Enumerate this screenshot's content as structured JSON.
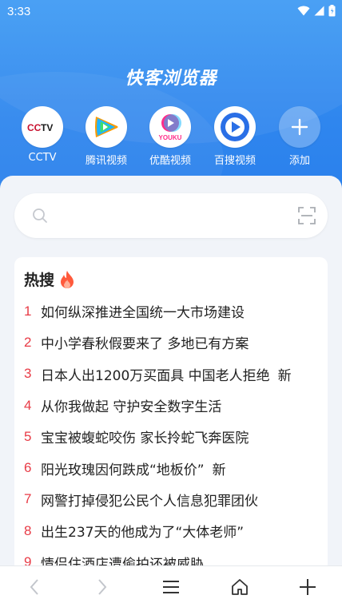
{
  "status": {
    "time": "3:33"
  },
  "app": {
    "title": "快客浏览器"
  },
  "shortcuts": [
    {
      "label": "CCTV",
      "icon": "cctv-logo-icon"
    },
    {
      "label": "腾讯视频",
      "icon": "tencent-video-icon"
    },
    {
      "label": "优酷视频",
      "icon": "youku-icon",
      "logo_text": "YOUKU"
    },
    {
      "label": "百搜视频",
      "icon": "baisou-video-icon"
    },
    {
      "label": "添加",
      "icon": "plus-icon"
    }
  ],
  "search": {
    "placeholder": ""
  },
  "hot": {
    "title": "热搜",
    "items": [
      {
        "rank": "1",
        "text": "如何纵深推进全国统一大市场建设"
      },
      {
        "rank": "2",
        "text": "中小学春秋假要来了 多地已有方案"
      },
      {
        "rank": "3",
        "text": "日本人出1200万买面具 中国老人拒绝",
        "badge": "新"
      },
      {
        "rank": "4",
        "text": "从你我做起 守护安全数字生活"
      },
      {
        "rank": "5",
        "text": "宝宝被蝮蛇咬伤 家长拎蛇飞奔医院"
      },
      {
        "rank": "6",
        "text": "阳光玫瑰因何跌成“地板价”",
        "badge": "新"
      },
      {
        "rank": "7",
        "text": "网警打掉侵犯公民个人信息犯罪团伙"
      },
      {
        "rank": "8",
        "text": "出生237天的他成为了“大体老师”"
      },
      {
        "rank": "9",
        "text": "情侣住酒店遭偷拍还被威胁"
      }
    ]
  },
  "colors": {
    "accent": "#2f86ee",
    "rank": "#e83b46"
  }
}
